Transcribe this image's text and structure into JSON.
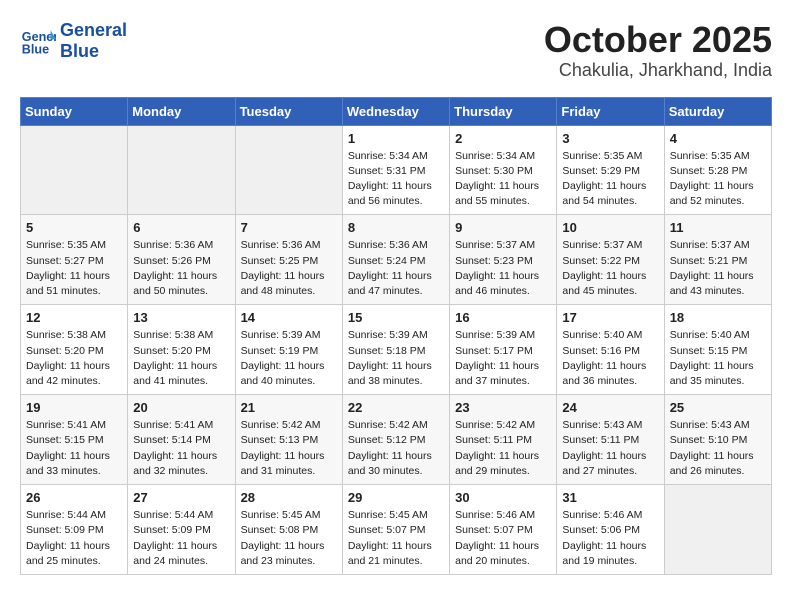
{
  "header": {
    "logo_line1": "General",
    "logo_line2": "Blue",
    "month": "October 2025",
    "location": "Chakulia, Jharkhand, India"
  },
  "weekdays": [
    "Sunday",
    "Monday",
    "Tuesday",
    "Wednesday",
    "Thursday",
    "Friday",
    "Saturday"
  ],
  "weeks": [
    [
      {
        "day": "",
        "empty": true
      },
      {
        "day": "",
        "empty": true
      },
      {
        "day": "",
        "empty": true
      },
      {
        "day": "1",
        "sunrise": "5:34 AM",
        "sunset": "5:31 PM",
        "daylight": "11 hours and 56 minutes."
      },
      {
        "day": "2",
        "sunrise": "5:34 AM",
        "sunset": "5:30 PM",
        "daylight": "11 hours and 55 minutes."
      },
      {
        "day": "3",
        "sunrise": "5:35 AM",
        "sunset": "5:29 PM",
        "daylight": "11 hours and 54 minutes."
      },
      {
        "day": "4",
        "sunrise": "5:35 AM",
        "sunset": "5:28 PM",
        "daylight": "11 hours and 52 minutes."
      }
    ],
    [
      {
        "day": "5",
        "sunrise": "5:35 AM",
        "sunset": "5:27 PM",
        "daylight": "11 hours and 51 minutes."
      },
      {
        "day": "6",
        "sunrise": "5:36 AM",
        "sunset": "5:26 PM",
        "daylight": "11 hours and 50 minutes."
      },
      {
        "day": "7",
        "sunrise": "5:36 AM",
        "sunset": "5:25 PM",
        "daylight": "11 hours and 48 minutes."
      },
      {
        "day": "8",
        "sunrise": "5:36 AM",
        "sunset": "5:24 PM",
        "daylight": "11 hours and 47 minutes."
      },
      {
        "day": "9",
        "sunrise": "5:37 AM",
        "sunset": "5:23 PM",
        "daylight": "11 hours and 46 minutes."
      },
      {
        "day": "10",
        "sunrise": "5:37 AM",
        "sunset": "5:22 PM",
        "daylight": "11 hours and 45 minutes."
      },
      {
        "day": "11",
        "sunrise": "5:37 AM",
        "sunset": "5:21 PM",
        "daylight": "11 hours and 43 minutes."
      }
    ],
    [
      {
        "day": "12",
        "sunrise": "5:38 AM",
        "sunset": "5:20 PM",
        "daylight": "11 hours and 42 minutes."
      },
      {
        "day": "13",
        "sunrise": "5:38 AM",
        "sunset": "5:20 PM",
        "daylight": "11 hours and 41 minutes."
      },
      {
        "day": "14",
        "sunrise": "5:39 AM",
        "sunset": "5:19 PM",
        "daylight": "11 hours and 40 minutes."
      },
      {
        "day": "15",
        "sunrise": "5:39 AM",
        "sunset": "5:18 PM",
        "daylight": "11 hours and 38 minutes."
      },
      {
        "day": "16",
        "sunrise": "5:39 AM",
        "sunset": "5:17 PM",
        "daylight": "11 hours and 37 minutes."
      },
      {
        "day": "17",
        "sunrise": "5:40 AM",
        "sunset": "5:16 PM",
        "daylight": "11 hours and 36 minutes."
      },
      {
        "day": "18",
        "sunrise": "5:40 AM",
        "sunset": "5:15 PM",
        "daylight": "11 hours and 35 minutes."
      }
    ],
    [
      {
        "day": "19",
        "sunrise": "5:41 AM",
        "sunset": "5:15 PM",
        "daylight": "11 hours and 33 minutes."
      },
      {
        "day": "20",
        "sunrise": "5:41 AM",
        "sunset": "5:14 PM",
        "daylight": "11 hours and 32 minutes."
      },
      {
        "day": "21",
        "sunrise": "5:42 AM",
        "sunset": "5:13 PM",
        "daylight": "11 hours and 31 minutes."
      },
      {
        "day": "22",
        "sunrise": "5:42 AM",
        "sunset": "5:12 PM",
        "daylight": "11 hours and 30 minutes."
      },
      {
        "day": "23",
        "sunrise": "5:42 AM",
        "sunset": "5:11 PM",
        "daylight": "11 hours and 29 minutes."
      },
      {
        "day": "24",
        "sunrise": "5:43 AM",
        "sunset": "5:11 PM",
        "daylight": "11 hours and 27 minutes."
      },
      {
        "day": "25",
        "sunrise": "5:43 AM",
        "sunset": "5:10 PM",
        "daylight": "11 hours and 26 minutes."
      }
    ],
    [
      {
        "day": "26",
        "sunrise": "5:44 AM",
        "sunset": "5:09 PM",
        "daylight": "11 hours and 25 minutes."
      },
      {
        "day": "27",
        "sunrise": "5:44 AM",
        "sunset": "5:09 PM",
        "daylight": "11 hours and 24 minutes."
      },
      {
        "day": "28",
        "sunrise": "5:45 AM",
        "sunset": "5:08 PM",
        "daylight": "11 hours and 23 minutes."
      },
      {
        "day": "29",
        "sunrise": "5:45 AM",
        "sunset": "5:07 PM",
        "daylight": "11 hours and 21 minutes."
      },
      {
        "day": "30",
        "sunrise": "5:46 AM",
        "sunset": "5:07 PM",
        "daylight": "11 hours and 20 minutes."
      },
      {
        "day": "31",
        "sunrise": "5:46 AM",
        "sunset": "5:06 PM",
        "daylight": "11 hours and 19 minutes."
      },
      {
        "day": "",
        "empty": true
      }
    ]
  ]
}
